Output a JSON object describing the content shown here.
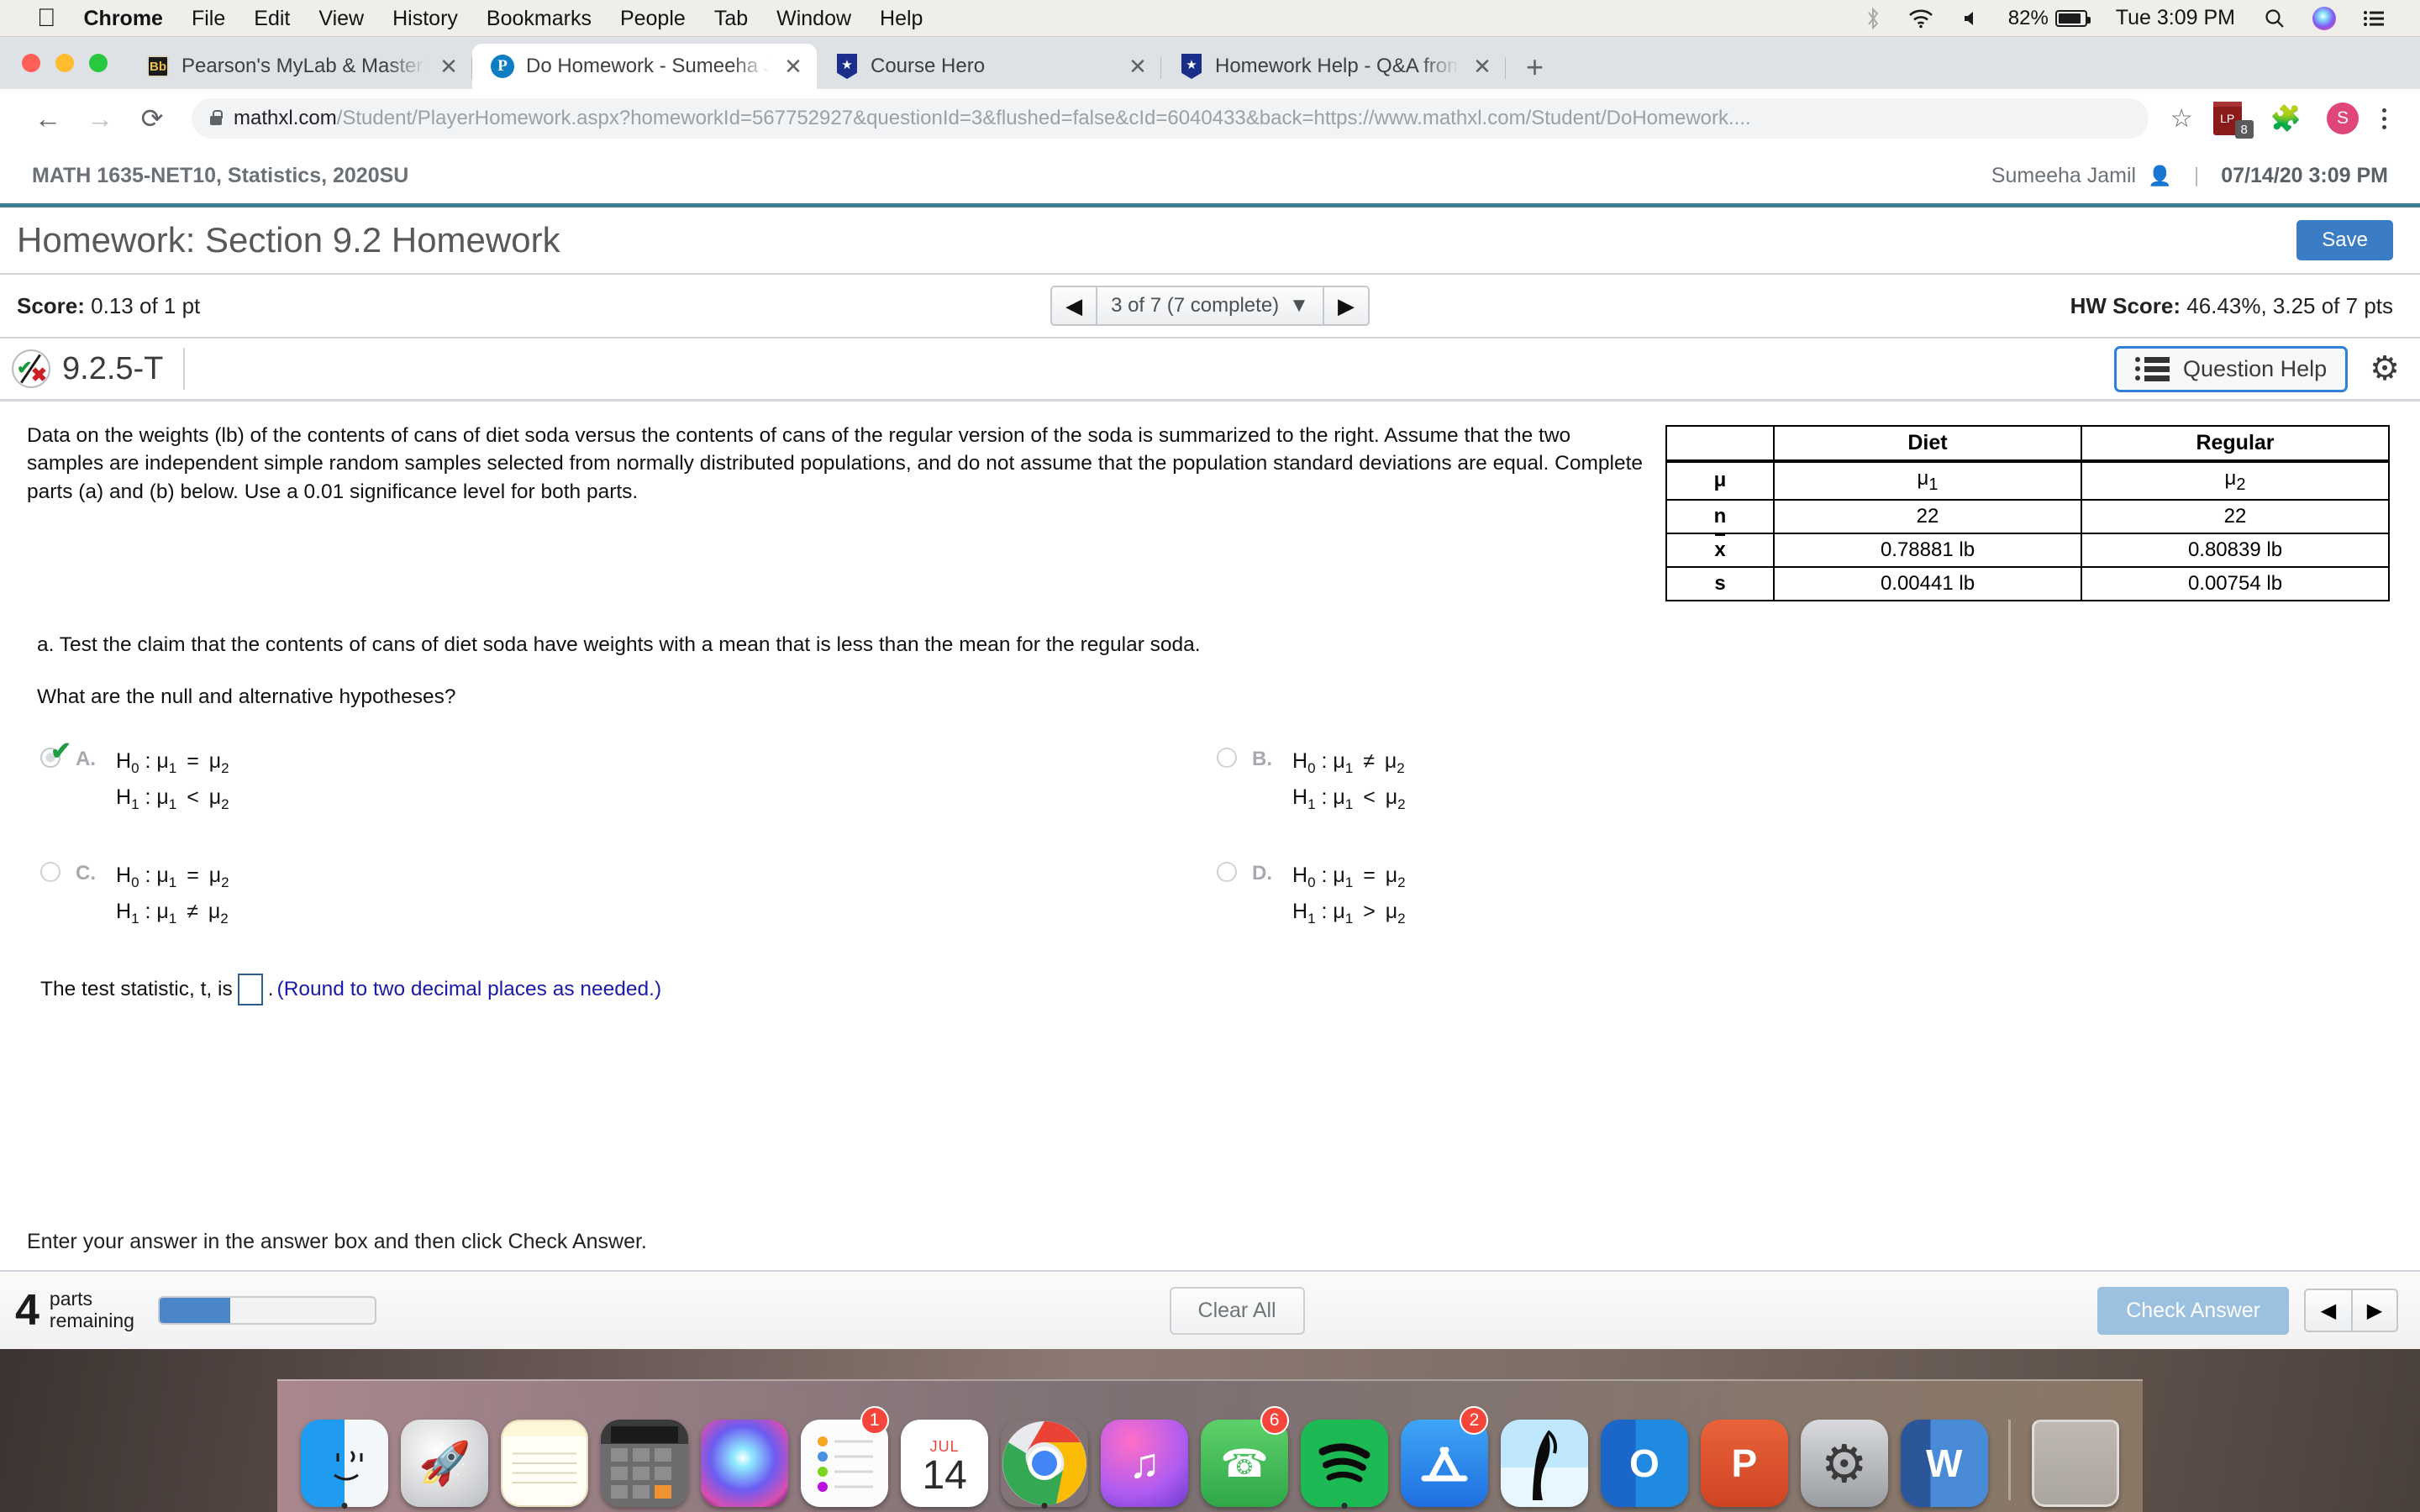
{
  "menubar": {
    "apple_icon": "apple-logo",
    "items": [
      "Chrome",
      "File",
      "Edit",
      "View",
      "History",
      "Bookmarks",
      "People",
      "Tab",
      "Window",
      "Help"
    ],
    "bluetooth_icon": "bluetooth-icon",
    "wifi_icon": "wifi-icon",
    "volume_icon": "volume-icon",
    "battery_percent": "82%",
    "clock": "Tue 3:09 PM",
    "search_icon": "spotlight-search-icon",
    "siri_icon": "siri-icon",
    "control_center_icon": "control-center-icon"
  },
  "browser": {
    "tabs": [
      {
        "title": "Pearson's MyLab & Mastering -",
        "favicon": "blackboard-icon",
        "active": false
      },
      {
        "title": "Do Homework - Sumeeha Jami",
        "favicon": "pearson-icon",
        "active": true
      },
      {
        "title": "Course Hero",
        "favicon": "coursehero-icon",
        "active": false
      },
      {
        "title": "Homework Help - Q&A from On",
        "favicon": "coursehero-icon",
        "active": false
      }
    ],
    "close_label": "✕",
    "new_tab_label": "+",
    "back_icon": "back-arrow-icon",
    "forward_icon": "forward-arrow-icon",
    "reload_icon": "reload-icon",
    "lock_icon": "lock-icon",
    "url_domain": "mathxl.com",
    "url_path": "/Student/PlayerHomework.aspx?homeworkId=567752927&questionId=3&flushed=false&cId=6040433&back=https://www.mathxl.com/Student/DoHomework....",
    "bookmark_icon": "star-icon",
    "extension_badge_count": "8",
    "extensions_icon": "puzzle-piece-icon",
    "profile_initial": "S",
    "menu_icon": "three-dot-menu-icon"
  },
  "mathxl_header": {
    "course": "MATH 1635-NET10, Statistics, 2020SU",
    "student": "Sumeeha Jamil",
    "person_icon": "person-icon",
    "separator": "|",
    "timestamp": "07/14/20 3:09 PM"
  },
  "assignment": {
    "title": "Homework: Section 9.2 Homework",
    "save_label": "Save",
    "score_label": "Score:",
    "score_value": "0.13 of 1 pt",
    "pager_prev": "◀",
    "pager_next": "▶",
    "pager_text": "3 of 7 (7 complete)",
    "pager_caret": "▼",
    "hw_score_label": "HW Score:",
    "hw_score_value": "46.43%, 3.25 of 7 pts"
  },
  "question_bar": {
    "status_icon": "partial-credit-check-x-icon",
    "question_id": "9.2.5-T",
    "question_help_label": "Question Help",
    "question_help_icon": "list-icon",
    "settings_icon": "gear-icon"
  },
  "problem": {
    "statement": "Data on the weights (lb) of the contents of cans of diet soda versus the contents of cans of the regular version of the soda is summarized to the right. Assume that the two samples are independent simple random samples selected from normally distributed populations, and do not assume that the population standard deviations are equal. Complete parts (a) and (b) below. Use a 0.01 significance level for both parts.",
    "part_a": "a. Test the claim that the contents of cans of diet soda have weights with a mean that is less than the mean for the regular soda.",
    "question_prompt": "What are the null and alternative hypotheses?",
    "test_statistic_pre": "The test statistic, t, is",
    "test_statistic_post": ".",
    "test_statistic_note": "(Round to two decimal places as needed.)",
    "answer_value": ""
  },
  "stats_table": {
    "columns": [
      "",
      "Diet",
      "Regular"
    ],
    "rows": [
      {
        "label": "μ",
        "diet": "μ1",
        "regular": "μ2"
      },
      {
        "label": "n",
        "diet": "22",
        "regular": "22"
      },
      {
        "label": "x",
        "diet": "0.78881 lb",
        "regular": "0.80839 lb"
      },
      {
        "label": "s",
        "diet": "0.00441 lb",
        "regular": "0.00754 lb"
      }
    ]
  },
  "choices": [
    {
      "letter": "A.",
      "h0": "H0 : μ1 = μ2",
      "h1": "H1 : μ1 < μ2",
      "selected": true,
      "correct": true
    },
    {
      "letter": "B.",
      "h0": "H0 : μ1 ≠ μ2",
      "h1": "H1 : μ1 < μ2",
      "selected": false,
      "correct": false
    },
    {
      "letter": "C.",
      "h0": "H0 : μ1 = μ2",
      "h1": "H1 : μ1 ≠ μ2",
      "selected": false,
      "correct": false
    },
    {
      "letter": "D.",
      "h0": "H0 : μ1 = μ2",
      "h1": "H1 : μ1 > μ2",
      "selected": false,
      "correct": false
    }
  ],
  "footer": {
    "hint": "Enter your answer in the answer box and then click Check Answer.",
    "help_icon_label": "?",
    "parts_number": "4",
    "parts_label_line1": "parts",
    "parts_label_line2": "remaining",
    "progress_percent": 33,
    "clear_all_label": "Clear All",
    "check_answer_label": "Check Answer",
    "nav_prev": "◀",
    "nav_next": "▶"
  },
  "dock": {
    "items": [
      {
        "name": "finder",
        "badge": "",
        "running": true
      },
      {
        "name": "launchpad",
        "badge": "",
        "running": false
      },
      {
        "name": "notes",
        "badge": "",
        "running": false
      },
      {
        "name": "calculator",
        "badge": "",
        "running": false
      },
      {
        "name": "siri",
        "badge": "",
        "running": false
      },
      {
        "name": "reminders",
        "badge": "1",
        "running": false
      },
      {
        "name": "calendar",
        "badge": "",
        "running": false,
        "cal_month": "JUL",
        "cal_day": "14"
      },
      {
        "name": "chrome",
        "badge": "",
        "running": true
      },
      {
        "name": "itunes",
        "badge": "",
        "running": false
      },
      {
        "name": "facetime",
        "badge": "6",
        "running": false
      },
      {
        "name": "spotify",
        "badge": "",
        "running": true
      },
      {
        "name": "app-store",
        "badge": "2",
        "running": false
      },
      {
        "name": "ibooks",
        "badge": "",
        "running": false
      },
      {
        "name": "outlook",
        "badge": "",
        "running": false,
        "glyph": "O"
      },
      {
        "name": "powerpoint",
        "badge": "",
        "running": false,
        "glyph": "P"
      },
      {
        "name": "system-preferences",
        "badge": "",
        "running": false
      },
      {
        "name": "word",
        "badge": "",
        "running": false,
        "glyph": "W"
      },
      {
        "name": "trash",
        "badge": "",
        "running": false
      }
    ]
  }
}
